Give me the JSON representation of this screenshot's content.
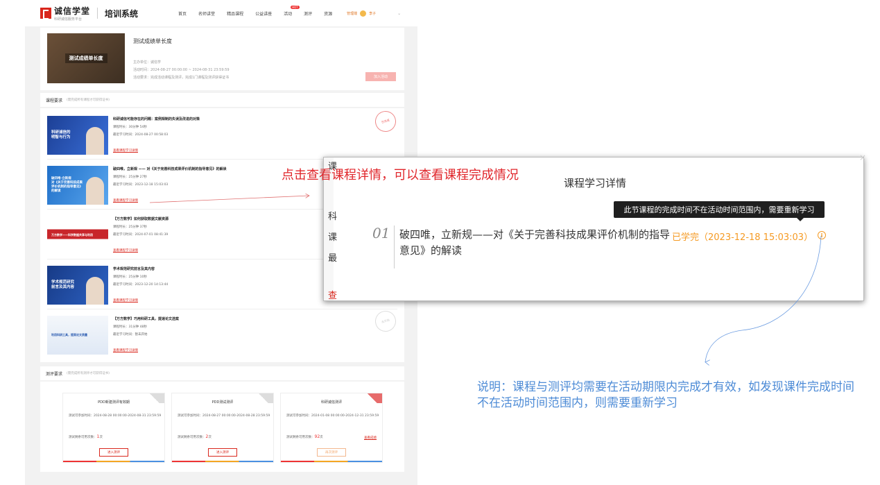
{
  "nav": {
    "logo_main": "诚信学堂",
    "logo_sub": "科研诚信服务平台",
    "system_name": "培训系统",
    "items": [
      "首页",
      "名师讲堂",
      "精品课程",
      "公益讲座",
      "活动",
      "测评",
      "资源"
    ],
    "hot_badge": "HOT",
    "user_extra": "管理端",
    "user_name": "李子",
    "more": "⌄"
  },
  "activity": {
    "image_caption": "测试成绩单长度",
    "title": "测试成绩单长度",
    "line1": "主办单位：诚信学",
    "line2": "活动时间：2024-08-27 00:00:00 ~ 2024-08-31 23:59:59",
    "line3": "活动要求：完成活动课程及测评，完成1门课程及测评获得证书",
    "join_label": "加入活动"
  },
  "course_section": {
    "heading": "课程要求",
    "sub": "(需完成所有课程才可获得证书)"
  },
  "courses": [
    {
      "thumb_text": "科研诚信的\n明智与行为",
      "title": "科研诚信可能存在的问题：案例规制的失误及改进的对策",
      "duration": "课程时长：30分钟 54秒",
      "last_learn": "最近学习时间：2024-08-27 00:58:03",
      "link": "查看课程学习详情",
      "stamp": "已完成"
    },
    {
      "thumb_text": "破四唯·立新规\n对《关于完善科技成果\n评价机制的指导意见》\n的解读",
      "title": "破四唯，立新规 —— 对《关于完善科技成果评价机制的指导意见》的解读",
      "duration": "课程时长：25分钟 27秒",
      "last_learn": "最近学习时间：2023-12-18 15:03:03",
      "link": "查看课程学习详情",
      "stamp": ""
    },
    {
      "thumb_text": "万方数学——科学数据共享与利用",
      "title": "【万方数学】如何获取数据文献资源",
      "duration": "课程时长：25分钟 37秒",
      "last_learn": "最近学习时间：2024-07-01 08:41:39",
      "link": "查看课程学习详情",
      "stamp": ""
    },
    {
      "thumb_text": "学术规范研究\n前言及其内容",
      "title": "学术规范研究前言及其内容",
      "duration": "课程时长：25分钟 10秒",
      "last_learn": "最近学习时间：2023-12-20 14:13:44",
      "link": "查看课程学习详情",
      "stamp": ""
    },
    {
      "thumb_text": "利用科研工具，提高论文质量",
      "title": "【万方数学】巧用科研工具，提速论文选案",
      "duration": "课程时长：31分钟 48秒",
      "last_learn": "最近学习时间：暂未开始",
      "link": "查看课程学习详情",
      "stamp": "未开始"
    }
  ],
  "exam_section": {
    "heading": "测评要求",
    "sub": "(需完成所有测评才可获得证书)"
  },
  "exams": [
    {
      "title": "PDD新建测评有效期",
      "time": "测试可参加时间：2024-08-28 00:00:00-2024-08-31 23:59:59",
      "count_label": "测试剩余可用次数：",
      "count": "1",
      "count_unit": "次",
      "button": "进入测评",
      "link": ""
    },
    {
      "title": "PDD测试测评",
      "time": "测试可参加时间：2024-08-27 00:00:00-2024-08-28 23:59:59",
      "count_label": "测试剩余可用次数：",
      "count": "2",
      "count_unit": "次",
      "button": "进入测评",
      "link": ""
    },
    {
      "title": "科研诚信测评",
      "time": "测试可参加时间：2024-01-08 00:00:00-2024-12-31 23:59:59",
      "count_label": "测试剩余可用次数：",
      "count": "92",
      "count_unit": "次",
      "button": "再次测评",
      "link": "查看成绩"
    }
  ],
  "popup": {
    "left_fragments": [
      "课",
      "科",
      "课",
      "最",
      "查"
    ],
    "title": "课程学习详情",
    "close": "×",
    "item_number": "01",
    "item_title": "破四唯，立新规——对《关于完善科技成果评价机制的指导意见》的解读",
    "item_status": "已学完（2023-12-18 15:03:03）",
    "info_glyph": "i",
    "tooltip": "此节课程的完成时间不在活动时间范围内，需要重新学习"
  },
  "annotations": {
    "red": "点击查看课程详情，可以查看课程完成情况",
    "blue": "说明：课程与测评均需要在活动期限内完成才有效，如发现课件完成时间不在活动时间范围内，则需要重新学习"
  },
  "colors": {
    "brand_red": "#d9261c",
    "status_orange": "#f59a23",
    "annotation_blue": "#4d8bd6",
    "annotation_red": "#e0262b"
  }
}
